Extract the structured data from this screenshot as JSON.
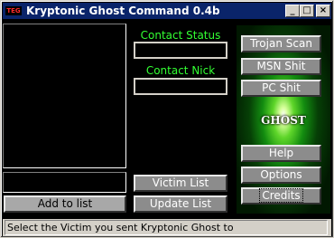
{
  "window": {
    "title": "Kryptonic Ghost Command 0.4b",
    "logo_text": "TEG",
    "minimize_label": "_",
    "maximize_label": "□",
    "close_label": "×"
  },
  "left": {
    "victim_list_items": [],
    "input_value": "",
    "add_button_label": "Add to list"
  },
  "middle": {
    "contact_status_label": "Contact Status",
    "contact_status_value": "",
    "contact_nick_label": "Contact Nick",
    "contact_nick_value": "",
    "victim_list_button": "Victim List",
    "update_list_button": "Update List"
  },
  "right": {
    "trojan_scan_button": "Trojan Scan",
    "msn_button": "MSN Shit",
    "pc_button": "PC Shit",
    "logo_text": "GHOST",
    "help_button": "Help",
    "options_button": "Options",
    "credits_button": "Credits"
  },
  "status": {
    "text": "Select the Victim you sent Kryptonic Ghost to"
  },
  "colors": {
    "title_bar": "#0a246a",
    "label_green": "#33ff33",
    "background": "#000000"
  }
}
